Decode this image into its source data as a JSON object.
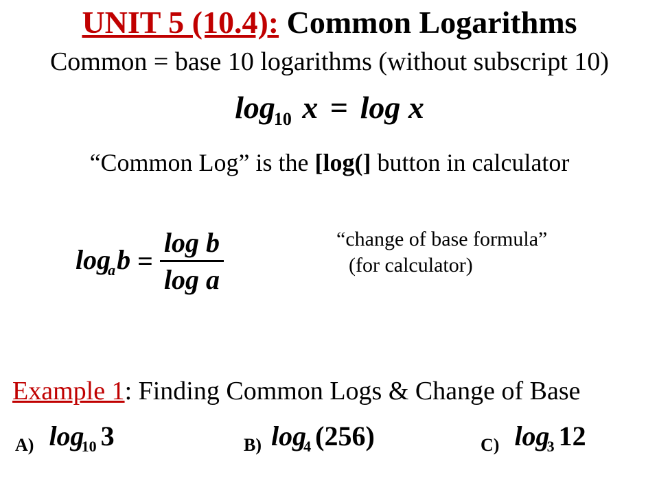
{
  "title": {
    "unit": "UNIT 5 (10.4):",
    "topic": " Common Logarithms"
  },
  "subtitle": "Common = base 10 logarithms (without subscript 10)",
  "identity": {
    "log_text": "log",
    "sub10": "10",
    "x": "x",
    "equals": "=",
    "log_text2": "log",
    "x2": "x"
  },
  "calc_line_pre": "“Common Log” is the ",
  "calc_line_strong": "[log(]",
  "calc_line_post": " button in calculator",
  "cob": {
    "log": "log",
    "a": "a",
    "b": "b",
    "eq": "=",
    "num_log": "log",
    "num_arg": "b",
    "den_log": "log",
    "den_arg": "a"
  },
  "cob_note_line1": "“change of base formula”",
  "cob_note_line2": "(for calculator)",
  "example": {
    "label": "Example 1",
    "rest": ": Finding Common Logs & Change of Base"
  },
  "parts": {
    "A": {
      "label": "A)",
      "log": "log",
      "sub": "10",
      "arg": "3"
    },
    "B": {
      "label": "B)",
      "log": "log",
      "sub": "4",
      "lp": "(",
      "arg": "256",
      "rp": ")"
    },
    "C": {
      "label": "C)",
      "log": "log",
      "sub": "3",
      "arg": "12"
    }
  }
}
